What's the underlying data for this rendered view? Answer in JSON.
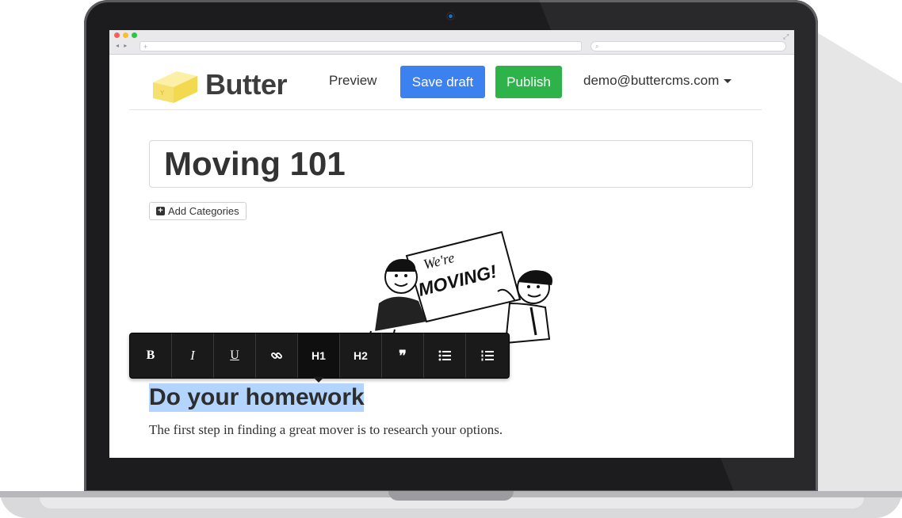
{
  "browser": {
    "url_text": "+",
    "search_icon": "magnifier-icon",
    "nav_arrows": "◂ ▸"
  },
  "header": {
    "logo_text": "Butter",
    "preview_label": "Preview",
    "save_draft_label": "Save draft",
    "publish_label": "Publish",
    "user_email": "demo@buttercms.com"
  },
  "editor": {
    "title": "Moving 101",
    "add_categories_label": "Add Categories",
    "illustration_sign_line1": "We're",
    "illustration_sign_line2": "MOVING!",
    "toolbar": {
      "bold": "B",
      "italic": "I",
      "underline": "U",
      "link_icon": "link-icon",
      "h1": "H1",
      "h2": "H2",
      "quote": "❞",
      "bullet_list_icon": "bullet-list-icon",
      "numbered_list_icon": "numbered-list-icon"
    },
    "section_heading": "Do your homework",
    "paragraph": "The first step in finding a great mover is to research your options."
  },
  "colors": {
    "draft_button": "#3b82f0",
    "publish_button": "#2eb24a",
    "selection_highlight": "#b3d4fc",
    "logo_yellow": "#f9ea8f"
  }
}
